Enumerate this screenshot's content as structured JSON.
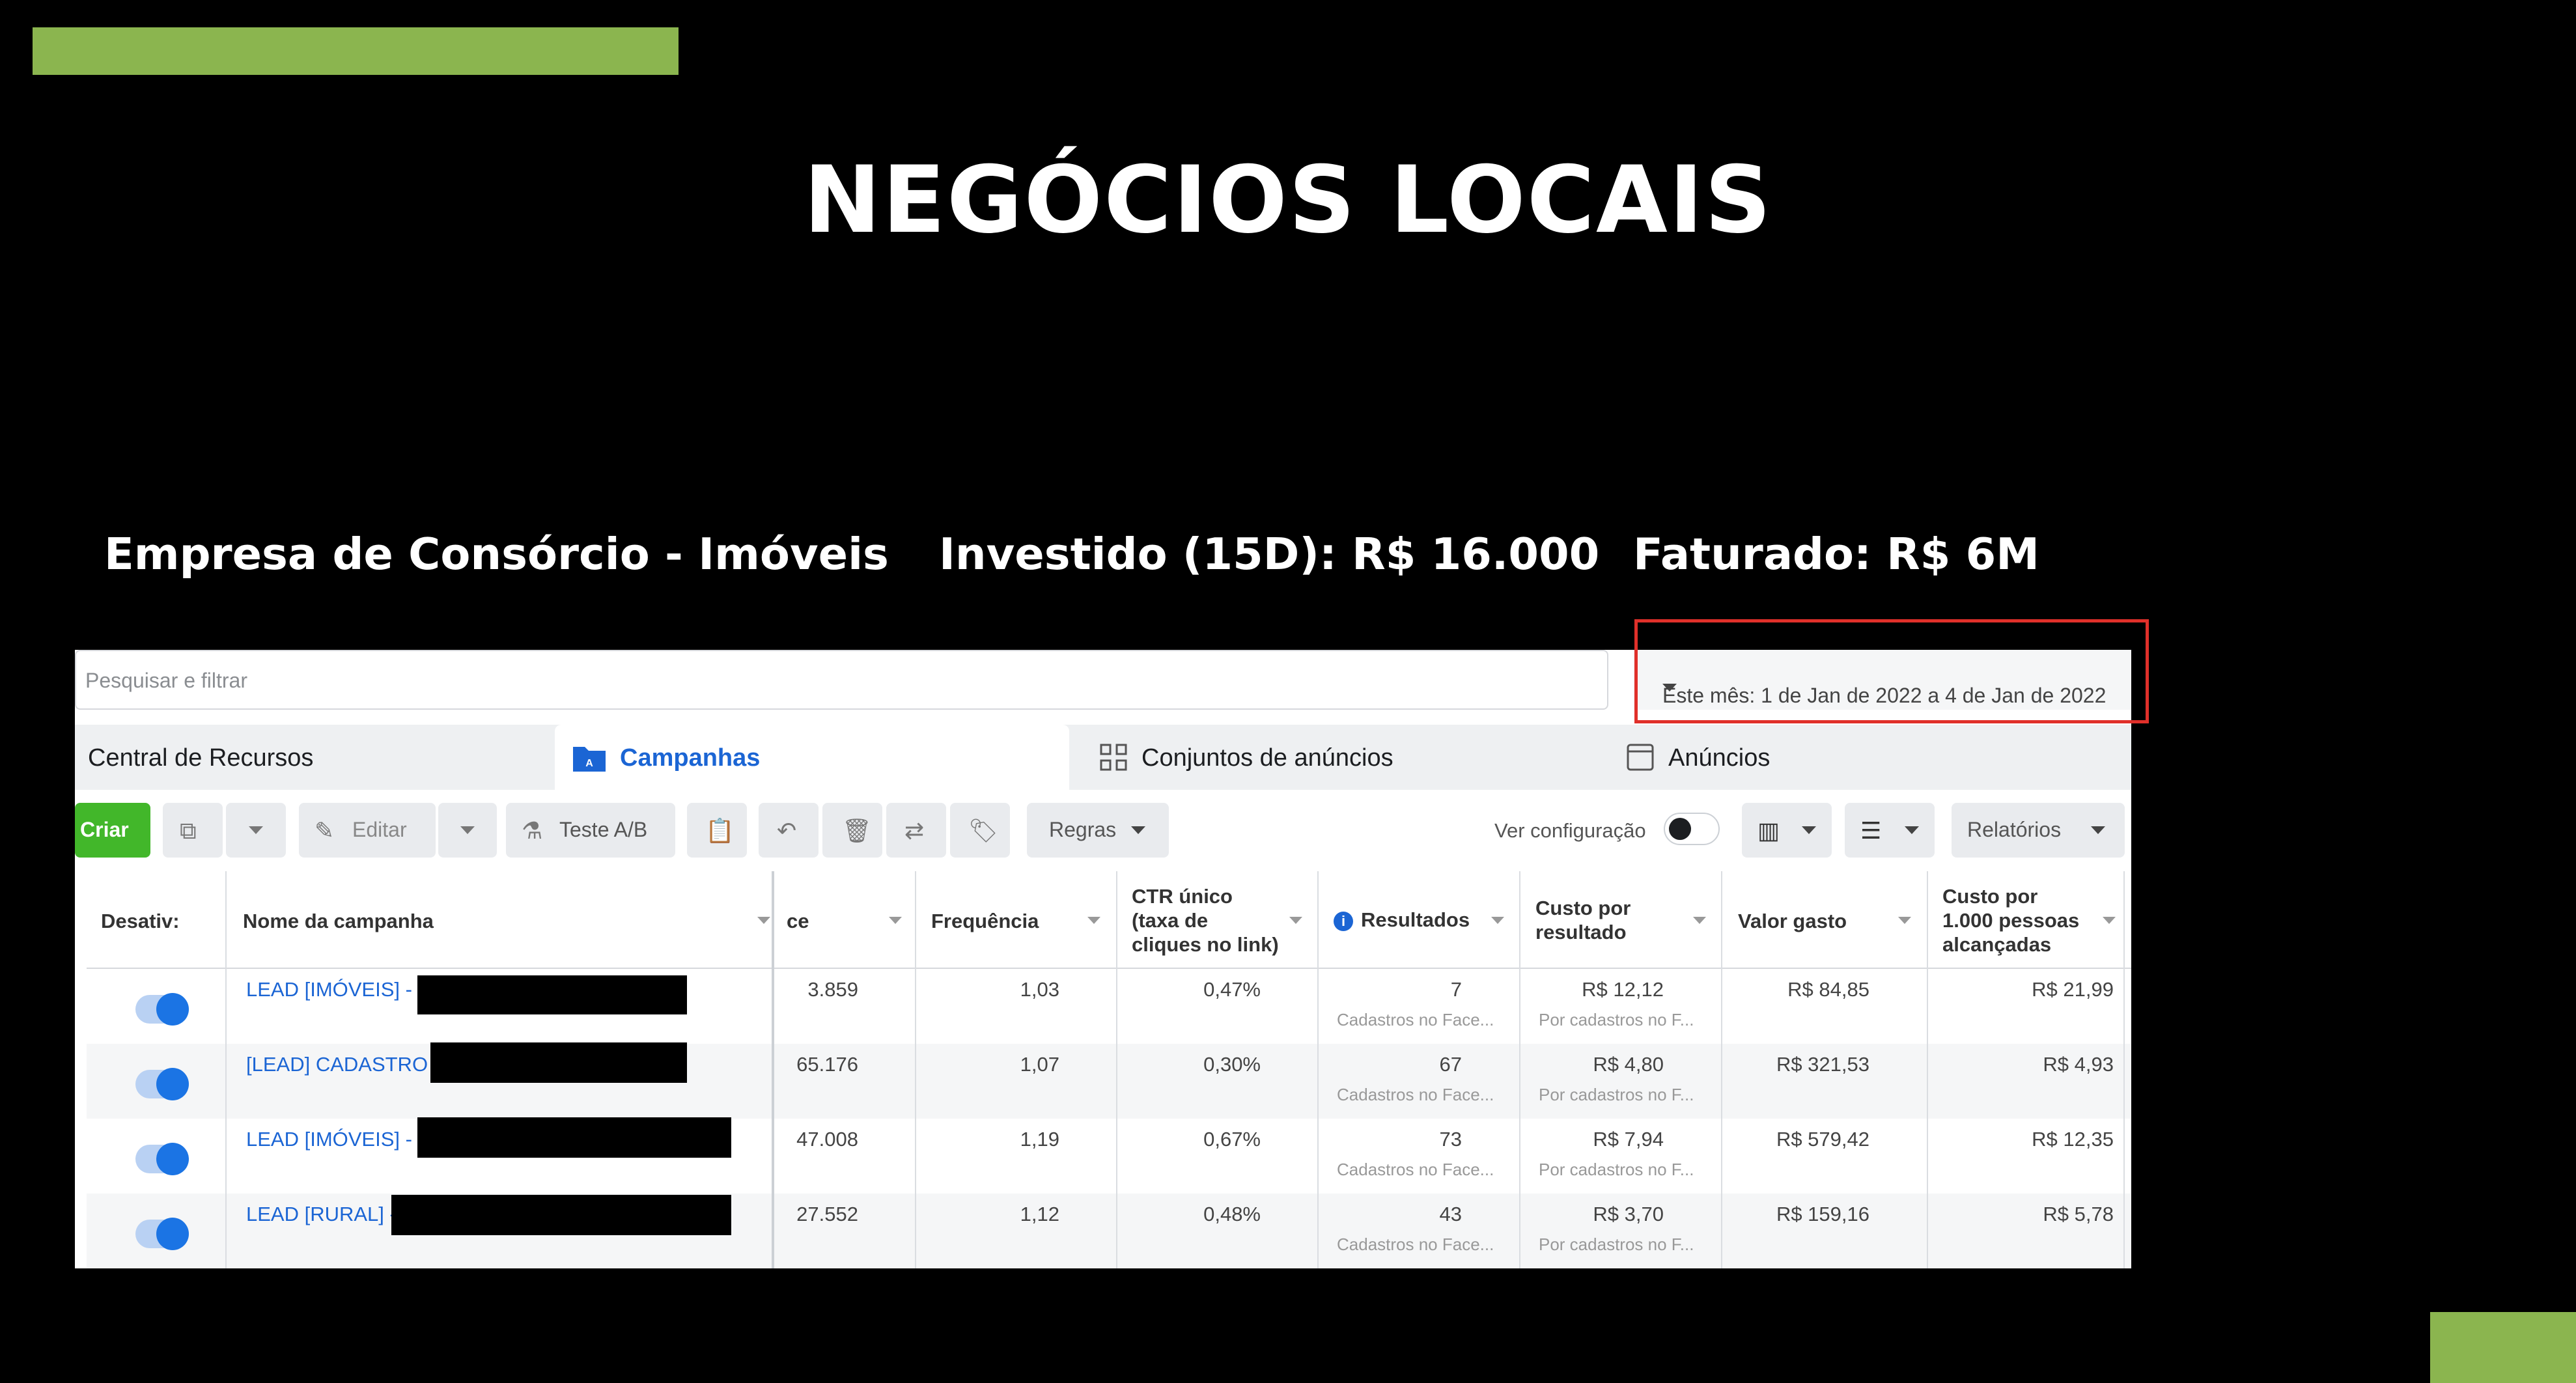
{
  "slide": {
    "title": "NEGÓCIOS LOCAIS",
    "stats": {
      "company": "Empresa de Consórcio - Imóveis",
      "invested": "Investido (15D): R$ 16.000",
      "revenue": "Faturado: R$ 6M"
    }
  },
  "colors": {
    "accent_green": "#8bb54f",
    "highlight_red": "#e0302a",
    "link_blue": "#1b65d4",
    "toggle_blue": "#1b74e4"
  },
  "search": {
    "placeholder": "Pesquisar e filtrar"
  },
  "date_range": {
    "label": "Este mês: 1 de Jan de 2022 a 4 de Jan de 2022"
  },
  "tabs": [
    {
      "label": "Central de Recursos",
      "icon": ""
    },
    {
      "label": "Campanhas",
      "icon": "folder-icon"
    },
    {
      "label": "Conjuntos de anúncios",
      "icon": "grid-icon"
    },
    {
      "label": "Anúncios",
      "icon": "ad-icon"
    }
  ],
  "toolbar": {
    "create": "Criar",
    "edit": "Editar",
    "ab_test": "Teste A/B",
    "rules": "Regras",
    "view_config": "Ver configuração",
    "reports": "Relatórios"
  },
  "table": {
    "headers": {
      "deactivate": "Desativ:",
      "name": "Nome da campanha",
      "reach": "ce",
      "frequency": "Frequência",
      "ctr_line1": "CTR único",
      "ctr_line2": "(taxa de",
      "ctr_line3": "cliques no link)",
      "results": "Resultados",
      "cpr_line1": "Custo por",
      "cpr_line2": "resultado",
      "spent": "Valor gasto",
      "cpm_line1": "Custo por",
      "cpm_line2": "1.000 pessoas",
      "cpm_line3": "alcançadas"
    },
    "rows": [
      {
        "name": "LEAD [IMÓVEIS] - (",
        "reach": "3.859",
        "frequency": "1,03",
        "ctr": "0,47%",
        "results": "7",
        "results_sub": "Cadastros no Face...",
        "cpr": "R$ 12,12",
        "cpr_sub": "Por cadastros no F...",
        "spent": "R$ 84,85",
        "cpm": "R$ 21,99"
      },
      {
        "name": "[LEAD] CADASTRO -",
        "reach": "65.176",
        "frequency": "1,07",
        "ctr": "0,30%",
        "results": "67",
        "results_sub": "Cadastros no Face...",
        "cpr": "R$ 4,80",
        "cpr_sub": "Por cadastros no F...",
        "spent": "R$ 321,53",
        "cpm": "R$ 4,93"
      },
      {
        "name": "LEAD [IMÓVEIS] - V",
        "reach": "47.008",
        "frequency": "1,19",
        "ctr": "0,67%",
        "results": "73",
        "results_sub": "Cadastros no Face...",
        "cpr": "R$ 7,94",
        "cpr_sub": "Por cadastros no F...",
        "spent": "R$ 579,42",
        "cpm": "R$ 12,35"
      },
      {
        "name": "LEAD [RURAL] - (",
        "reach": "27.552",
        "frequency": "1,12",
        "ctr": "0,48%",
        "results": "43",
        "results_sub": "Cadastros no Face...",
        "cpr": "R$ 3,70",
        "cpr_sub": "Por cadastros no F...",
        "spent": "R$ 159,16",
        "cpm": "R$ 5,78"
      }
    ]
  }
}
